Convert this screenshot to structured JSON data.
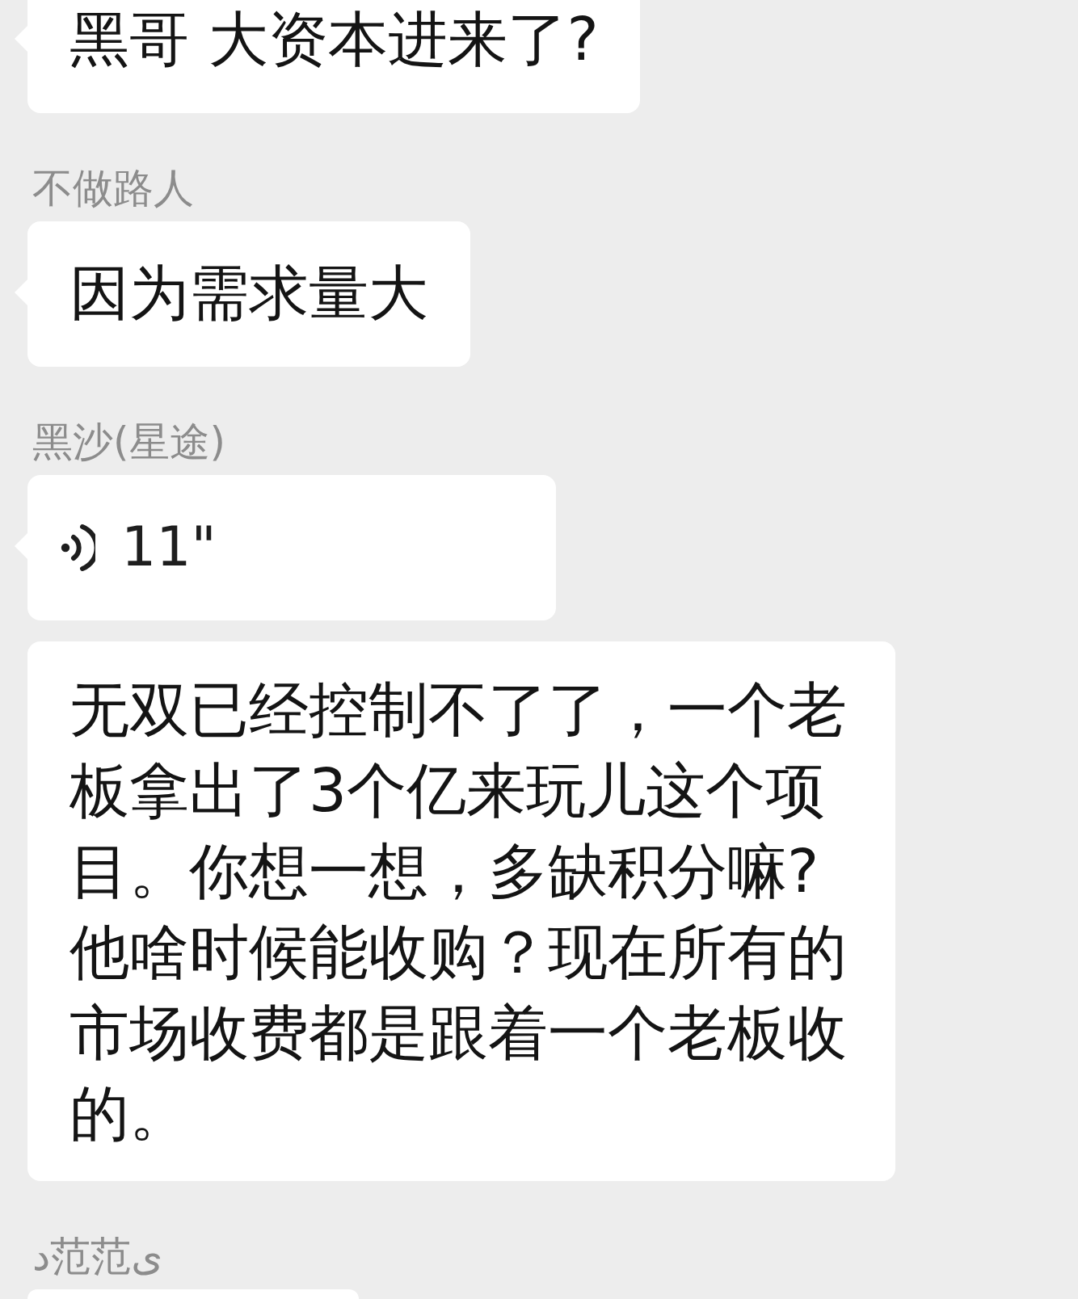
{
  "messages": [
    {
      "kind": "text",
      "text": "黑哥 大资本进来了?"
    },
    {
      "sender": "不做路人",
      "kind": "text",
      "text": "因为需求量大"
    },
    {
      "sender": "黑沙(星途)",
      "kind": "voice",
      "duration": "11\""
    },
    {
      "kind": "text",
      "text": "无双已经控制不了了，一个老板拿出了3个亿来玩儿这个项目。你想一想，多缺积分嘛?他啥时候能收购？现在所有的市场收费都是跟着一个老板收的。"
    },
    {
      "sender": "د范范ی",
      "kind": "text"
    }
  ]
}
